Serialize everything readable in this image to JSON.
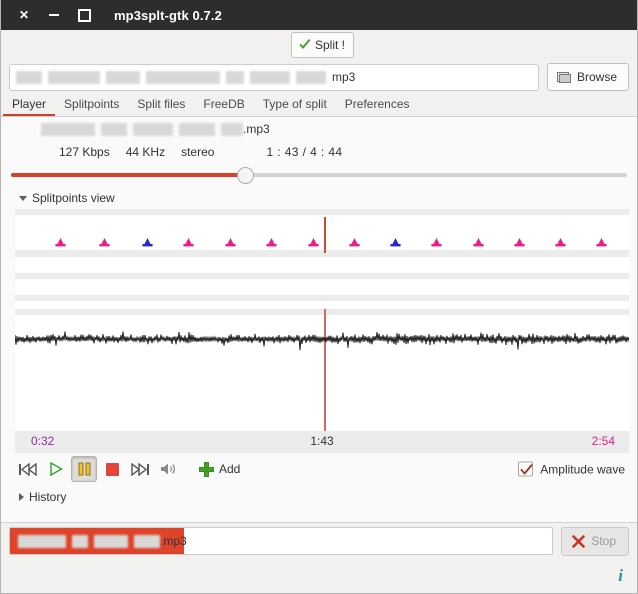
{
  "window": {
    "title": "mp3splt-gtk 0.7.2",
    "close_label": "close-window",
    "minimize_label": "minimize-window",
    "maximize_label": "maximize-window"
  },
  "toolbar": {
    "split_label": "Split !"
  },
  "path_row": {
    "redacted_blocks": [
      26,
      52,
      34,
      74,
      18,
      40,
      30
    ],
    "value_suffix": "mp3",
    "browse_label": "Browse"
  },
  "tabs": {
    "items": [
      {
        "label": "Player",
        "active": true
      },
      {
        "label": "Splitpoints",
        "active": false
      },
      {
        "label": "Split files",
        "active": false
      },
      {
        "label": "FreeDB",
        "active": false
      },
      {
        "label": "Type of split",
        "active": false
      },
      {
        "label": "Preferences",
        "active": false
      }
    ]
  },
  "player": {
    "file_redacted_blocks": [
      54,
      26,
      40,
      36,
      22
    ],
    "file_suffix": ".mp3",
    "bitrate": "127 Kbps",
    "samplerate": "44 KHz",
    "channels": "stereo",
    "position": "1 : 43 / 4 : 44",
    "seek_percent": 38
  },
  "splitpoints_view": {
    "label": "Splitpoints view",
    "expanded": true,
    "marker_color_normal": "#ec1f8a",
    "marker_color_selected": "#2b2bc8",
    "playhead_color": "#d26a5c",
    "markers": [
      {
        "x_percent": 7.4,
        "selected": false
      },
      {
        "x_percent": 14.6,
        "selected": false
      },
      {
        "x_percent": 21.5,
        "selected": true
      },
      {
        "x_percent": 28.3,
        "selected": false
      },
      {
        "x_percent": 35.1,
        "selected": false
      },
      {
        "x_percent": 41.8,
        "selected": false
      },
      {
        "x_percent": 48.6,
        "selected": false
      },
      {
        "x_percent": 55.3,
        "selected": false
      },
      {
        "x_percent": 62.0,
        "selected": true
      },
      {
        "x_percent": 68.7,
        "selected": false
      },
      {
        "x_percent": 75.5,
        "selected": false
      },
      {
        "x_percent": 82.2,
        "selected": false
      },
      {
        "x_percent": 88.9,
        "selected": false
      },
      {
        "x_percent": 95.6,
        "selected": false
      }
    ],
    "playhead_percent": 50.4,
    "times": {
      "left": "0:32",
      "center": "1:43",
      "right": "2:54",
      "left_color": "#8a2fa0",
      "center_color": "#2e3436",
      "right_color": "#e0218a"
    }
  },
  "transport": {
    "buttons": [
      {
        "name": "previous-track-button",
        "icon": "skip-backward-icon",
        "state": "normal"
      },
      {
        "name": "play-button",
        "icon": "play-icon",
        "state": "normal"
      },
      {
        "name": "pause-button",
        "icon": "pause-icon",
        "state": "pressed"
      },
      {
        "name": "stop-playback-button",
        "icon": "stop-icon",
        "state": "normal"
      },
      {
        "name": "next-track-button",
        "icon": "skip-forward-icon",
        "state": "normal"
      },
      {
        "name": "volume-button",
        "icon": "speaker-icon",
        "state": "normal"
      }
    ],
    "add_label": "Add",
    "amplitude_wave_label": "Amplitude wave",
    "amplitude_wave_checked": true
  },
  "history": {
    "label": "History",
    "expanded": false
  },
  "status": {
    "progress_percent": 32,
    "redacted_blocks": [
      48,
      16,
      34,
      26
    ],
    "file_suffix": ".mp3",
    "stop_label": "Stop",
    "stop_enabled": false,
    "info_glyph": "i"
  }
}
